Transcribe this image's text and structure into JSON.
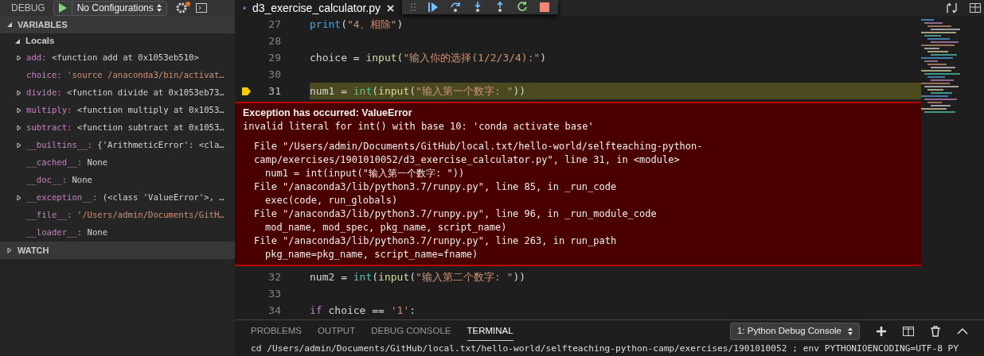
{
  "debug_bar": {
    "label": "DEBUG",
    "configuration": "No Configurations",
    "settings_badge": true
  },
  "sidebar": {
    "sections": [
      {
        "title": "VARIABLES",
        "expanded": true,
        "scopes": [
          {
            "title": "Locals",
            "expanded": true,
            "variables": [
              {
                "name": "add:",
                "value": "<function add at 0x1053eb510>",
                "kind": "object"
              },
              {
                "name": "choice:",
                "value": "'source /anaconda3/bin/activat…",
                "kind": "string"
              },
              {
                "name": "divide:",
                "value": "<function divide at 0x1053eb73…",
                "kind": "object"
              },
              {
                "name": "multiply:",
                "value": "<function multiply at 0x1053…",
                "kind": "object"
              },
              {
                "name": "subtract:",
                "value": "<function subtract at 0x1053…",
                "kind": "object"
              },
              {
                "name": "__builtins__:",
                "value": "{'ArithmeticError': <cla…",
                "kind": "object"
              },
              {
                "name": "__cached__:",
                "value": "None",
                "kind": "none"
              },
              {
                "name": "__doc__:",
                "value": "None",
                "kind": "none"
              },
              {
                "name": "__exception__:",
                "value": "(<class 'ValueError'>, …",
                "kind": "object"
              },
              {
                "name": "__file__:",
                "value": "'/Users/admin/Documents/GitH…",
                "kind": "string"
              },
              {
                "name": "__loader__:",
                "value": "None",
                "kind": "none"
              }
            ]
          }
        ]
      },
      {
        "title": "WATCH",
        "expanded": false
      }
    ]
  },
  "editor": {
    "tab": {
      "title": "d3_exercise_calculator.py"
    },
    "lines_before": [
      {
        "number": "27",
        "current": false,
        "tokens": [
          {
            "kind": "builtin",
            "text": "print"
          },
          {
            "kind": "plain",
            "text": "("
          },
          {
            "kind": "string",
            "text": "\"4、相除\""
          },
          {
            "kind": "plain",
            "text": ")"
          }
        ]
      },
      {
        "number": "28",
        "current": false
      },
      {
        "number": "29",
        "current": false,
        "tokens": [
          {
            "kind": "plain",
            "text": "choice = "
          },
          {
            "kind": "function",
            "text": "input"
          },
          {
            "kind": "plain",
            "text": "("
          },
          {
            "kind": "string",
            "text": "\"输入你的选择(1/2/3/4):\""
          },
          {
            "kind": "plain",
            "text": ")"
          }
        ]
      },
      {
        "number": "30",
        "current": false
      },
      {
        "number": "31",
        "current": true,
        "tokens": [
          {
            "kind": "plain",
            "text": "num1 = "
          },
          {
            "kind": "type",
            "text": "int"
          },
          {
            "kind": "plain",
            "text": "("
          },
          {
            "kind": "function",
            "text": "input"
          },
          {
            "kind": "plain",
            "text": "("
          },
          {
            "kind": "string",
            "text": "\"输入第一个数字: \""
          },
          {
            "kind": "plain",
            "text": "))"
          }
        ]
      }
    ],
    "exception": {
      "title": "Exception has occurred: ValueError",
      "message": "invalid literal for int() with base 10: 'conda activate base'",
      "trace": [
        {
          "kind": "frame",
          "text": "File \"/Users/admin/Documents/GitHub/local.txt/hello-world/selfteaching-python-camp/exercises/1901010052/d3_exercise_calculator.py\", line 31, in <module>"
        },
        {
          "kind": "source",
          "text": "num1 = int(input(\"输入第一个数字: \"))"
        },
        {
          "kind": "frame",
          "text": "File \"/anaconda3/lib/python3.7/runpy.py\", line 85, in _run_code"
        },
        {
          "kind": "source",
          "text": "exec(code, run_globals)"
        },
        {
          "kind": "frame",
          "text": "File \"/anaconda3/lib/python3.7/runpy.py\", line 96, in _run_module_code"
        },
        {
          "kind": "source",
          "text": "mod_name, mod_spec, pkg_name, script_name)"
        },
        {
          "kind": "frame",
          "text": "File \"/anaconda3/lib/python3.7/runpy.py\", line 263, in run_path"
        },
        {
          "kind": "source",
          "text": "pkg_name=pkg_name, script_name=fname)"
        }
      ]
    },
    "lines_after": [
      {
        "number": "32",
        "current": false,
        "tokens": [
          {
            "kind": "plain",
            "text": "num2 = "
          },
          {
            "kind": "type",
            "text": "int"
          },
          {
            "kind": "plain",
            "text": "("
          },
          {
            "kind": "function",
            "text": "input"
          },
          {
            "kind": "plain",
            "text": "("
          },
          {
            "kind": "string",
            "text": "\"输入第二个数字: \""
          },
          {
            "kind": "plain",
            "text": "))"
          }
        ]
      },
      {
        "number": "33",
        "current": false
      },
      {
        "number": "34",
        "current": false,
        "tokens": [
          {
            "kind": "keyword",
            "text": "if"
          },
          {
            "kind": "plain",
            "text": " choice == "
          },
          {
            "kind": "string",
            "text": "'1'"
          },
          {
            "kind": "plain",
            "text": ":"
          }
        ]
      }
    ]
  },
  "panel": {
    "tabs": [
      {
        "label": "PROBLEMS",
        "selected": false
      },
      {
        "label": "OUTPUT",
        "selected": false
      },
      {
        "label": "DEBUG CONSOLE",
        "selected": false
      },
      {
        "label": "TERMINAL",
        "selected": true
      }
    ],
    "terminal_select": "1: Python Debug Console",
    "terminal_lines": [
      "cd /Users/admin/Documents/GitHub/local.txt/hello-world/selfteaching-python-camp/exercises/1901010052 ; env PYTHONIOENCODING=UTF-8 PY"
    ]
  }
}
